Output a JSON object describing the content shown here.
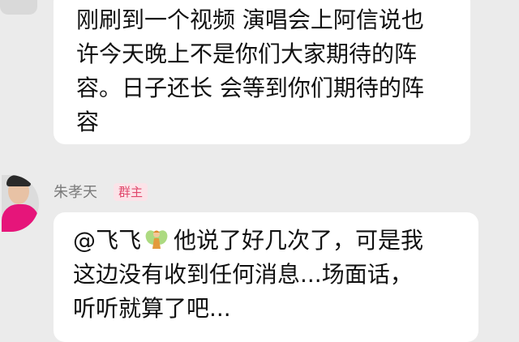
{
  "messages": [
    {
      "lines": [
        "刚刷到一个视频 演唱会上阿信说也",
        "许今天晚上不是你们大家期待的阵",
        "容。日子还长 会等到你们期待的阵",
        "容"
      ]
    },
    {
      "sender": "朱孝天",
      "role": "群主",
      "mention": "@飞飞",
      "mention_icon": "fairy-icon",
      "first_line_rest": "他说了好几次了，可是我",
      "lines": [
        "这边没有收到任何消息...场面话，",
        "听听就算了吧..."
      ]
    }
  ],
  "colors": {
    "background": "#ebebeb",
    "bubble": "#ffffff",
    "role_badge_text": "#e0476b",
    "role_badge_bg": "#fbe3e8",
    "avatar_shirt": "#e6157a"
  }
}
